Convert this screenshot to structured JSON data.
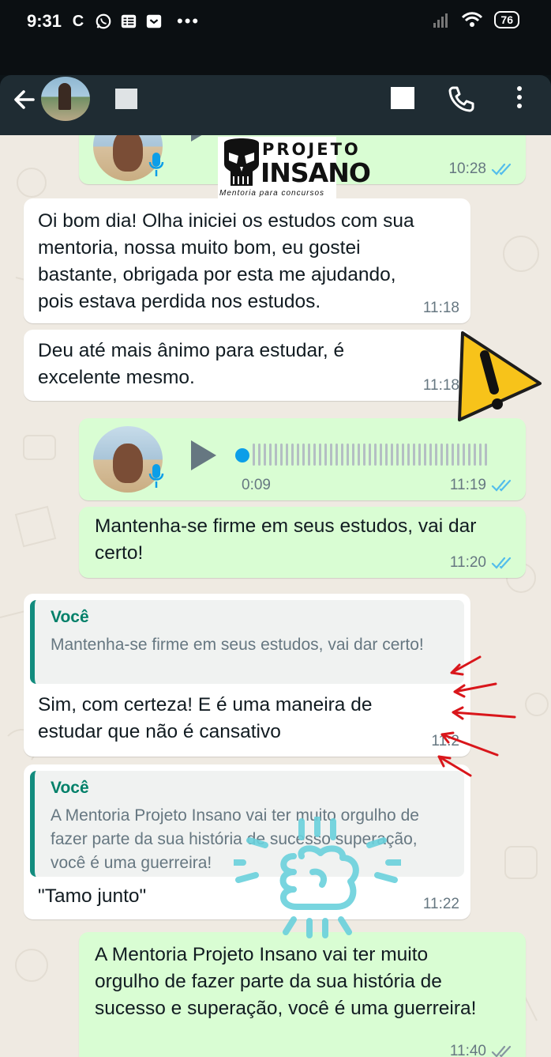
{
  "status_bar": {
    "time": "9:31",
    "left_icons": [
      "C",
      "whatsapp-icon",
      "notes-icon",
      "pocket-icon"
    ],
    "dots": "•••",
    "battery": "76"
  },
  "header": {
    "back_icon": "arrow-left-icon",
    "contact_avatar": "beach-photo"
  },
  "logo": {
    "line1": "PROJETO",
    "line2": "INSANO",
    "tagline": "Mentoria para concursos"
  },
  "messages": [
    {
      "id": "voice1",
      "type": "voice_out",
      "time": "10:28"
    },
    {
      "id": "m1",
      "type": "in",
      "text": "Oi bom dia! Olha iniciei os estudos com sua mentoria, nossa muito bom, eu gostei bastante, obrigada por esta me ajudando, pois estava perdida nos estudos.",
      "time": "11:18"
    },
    {
      "id": "m2",
      "type": "in",
      "text": "Deu até mais ânimo para estudar, é excelente mesmo.",
      "time": "11:18"
    },
    {
      "id": "voice2",
      "type": "voice_out",
      "duration": "0:09",
      "time": "11:19"
    },
    {
      "id": "m3",
      "type": "out",
      "text": "Mantenha-se firme em seus estudos, vai dar certo!",
      "time": "11:20"
    },
    {
      "id": "m4",
      "type": "in_reply",
      "quote_author": "Você",
      "quote_text": "Mantenha-se firme em seus estudos, vai dar certo!",
      "text": "Sim, com certeza! E é uma maneira de estudar que não é cansativo",
      "time": "11:2"
    },
    {
      "id": "m5",
      "type": "in_reply",
      "quote_author": "Você",
      "quote_text": "A Mentoria Projeto Insano vai ter muito orgulho de fazer parte da sua história de sucesso superação, você é uma guerreira!",
      "text": "\"Tamo junto\"",
      "time": "11:22"
    },
    {
      "id": "m6",
      "type": "out",
      "text": "A Mentoria Projeto Insano vai ter muito orgulho de fazer parte da sua história de sucesso e superação, você é uma guerreira!",
      "time": "11:40"
    }
  ],
  "colors": {
    "header_bg": "#1f2c33",
    "chat_bg": "#efeae2",
    "incoming_bubble": "#ffffff",
    "outgoing_bubble": "#d9fdd3",
    "read_ticks": "#53bdeb",
    "quote_author": "#008069"
  }
}
